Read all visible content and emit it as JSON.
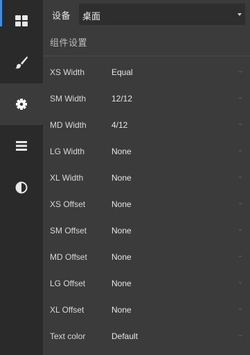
{
  "rail": {
    "items": [
      {
        "icon": "grid-icon",
        "active": false
      },
      {
        "icon": "brush-icon",
        "active": false
      },
      {
        "icon": "gear-icon",
        "active": true
      },
      {
        "icon": "menu-lines-icon",
        "active": false
      },
      {
        "icon": "contrast-icon",
        "active": false
      }
    ]
  },
  "device": {
    "label": "设备",
    "selected": "桌面"
  },
  "section": {
    "title": "组件设置"
  },
  "settings": [
    {
      "label": "XS Width",
      "value": "Equal"
    },
    {
      "label": "SM Width",
      "value": "12/12"
    },
    {
      "label": "MD Width",
      "value": "4/12"
    },
    {
      "label": "LG Width",
      "value": "None"
    },
    {
      "label": "XL Width",
      "value": "None"
    },
    {
      "label": "XS Offset",
      "value": "None"
    },
    {
      "label": "SM Offset",
      "value": "None"
    },
    {
      "label": "MD Offset",
      "value": "None"
    },
    {
      "label": "LG Offset",
      "value": "None"
    },
    {
      "label": "XL Offset",
      "value": "None"
    },
    {
      "label": "Text color",
      "value": "Default"
    }
  ],
  "colors": {
    "rail_bg": "#2a2a2a",
    "panel_bg": "#3b3b3b",
    "accent": "#4a8bd1"
  }
}
